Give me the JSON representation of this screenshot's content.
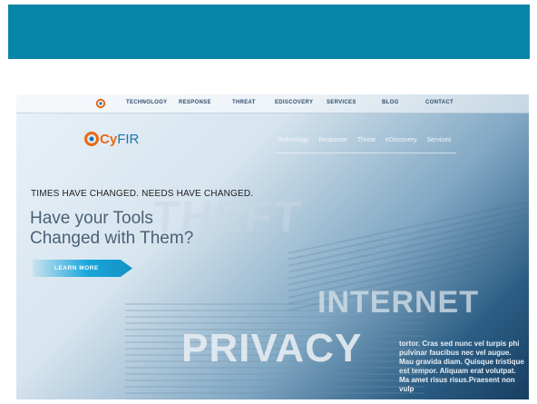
{
  "topnav": {
    "items": [
      "TECHNOLOGY",
      "RESPONSE",
      "THREAT",
      "EDISCOVERY",
      "SERVICES",
      "BLOG",
      "CONTACT"
    ]
  },
  "logo": {
    "prefix": "Cy",
    "suffix": "FIR"
  },
  "mainnav": {
    "items": [
      "Technology",
      "Response",
      "Threat",
      "eDiscovery",
      "Services"
    ]
  },
  "hero": {
    "headline": "TIMES HAVE CHANGED. NEEDS HAVE CHANGED.",
    "title_line1": "Have your Tools",
    "title_line2": "Changed with Them?",
    "cta": "LEARN MORE"
  },
  "background_words": {
    "word1": "THEFT",
    "word2": "INTERNET",
    "word3": "PRIVACY"
  },
  "background_text": "tortor. Cras sed nunc vel turpis phi pulvinar faucibus nec vel augue. Mau gravida diam. Quisque tristique est tempor. Aliquam erat volutpat. Ma amet risus risus.Praesent non vulp",
  "colors": {
    "top_band": "#0a85aa",
    "accent_blue": "#1aa7dc",
    "logo_orange": "#e76a14"
  }
}
